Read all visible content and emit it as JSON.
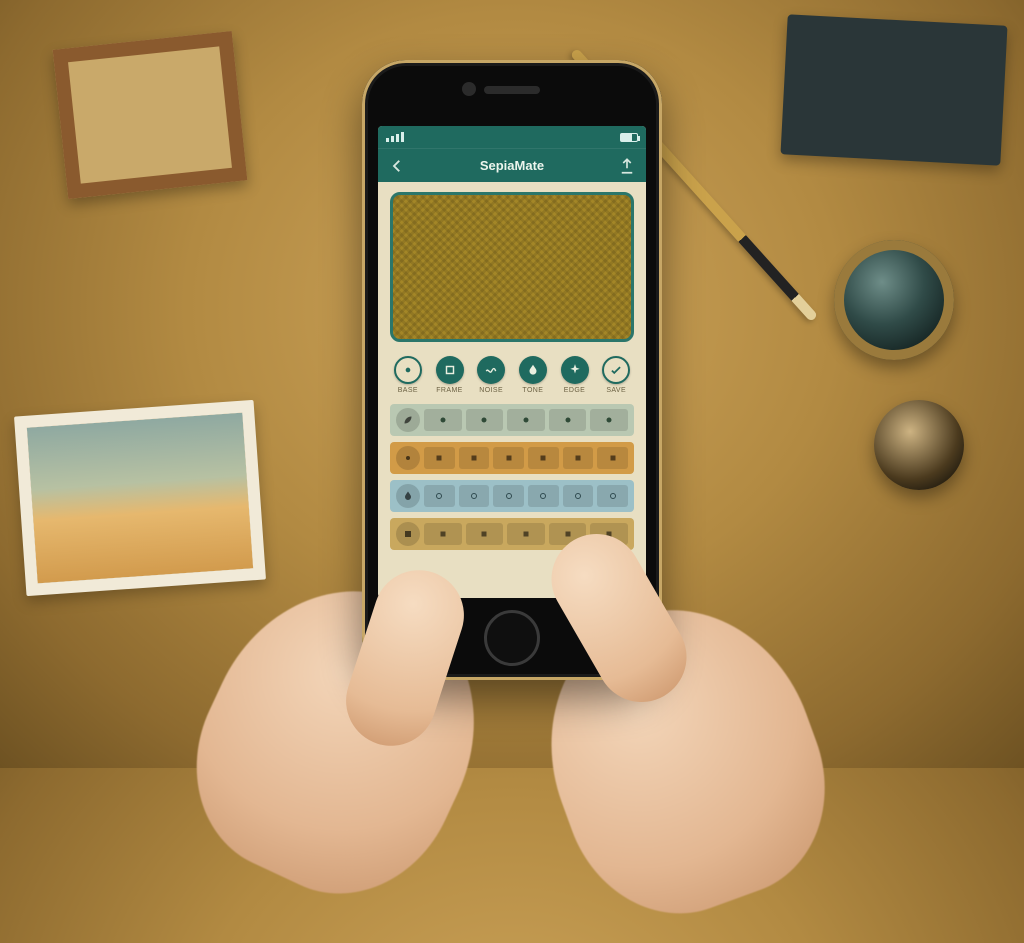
{
  "status": {
    "carrier_bars": 4
  },
  "header": {
    "title": "SepiaMate",
    "left_icon": "back-icon",
    "right_icon": "export-icon"
  },
  "chips": [
    {
      "label": "BASE",
      "icon": "sun-icon",
      "style": "outline"
    },
    {
      "label": "FRAME",
      "icon": "square-icon",
      "style": "solid"
    },
    {
      "label": "NOISE",
      "icon": "wave-icon",
      "style": "solid"
    },
    {
      "label": "TONE",
      "icon": "drop-icon",
      "style": "solid"
    },
    {
      "label": "EDGE",
      "icon": "spark-icon",
      "style": "solid"
    },
    {
      "label": "SAVE",
      "icon": "check-icon",
      "style": "outline"
    }
  ],
  "tool_rows": [
    {
      "tone": "a",
      "lead": "leaf-icon",
      "tools": [
        "blob1",
        "blob2",
        "blob3",
        "blob4",
        "blob5"
      ]
    },
    {
      "tone": "b",
      "lead": "sun-icon",
      "tools": [
        "sq",
        "sq",
        "txt",
        "sq",
        "sq",
        "sq"
      ]
    },
    {
      "tone": "c",
      "lead": "drop-icon",
      "tools": [
        "ring",
        "ring",
        "ring",
        "ring",
        "ring",
        "ring"
      ]
    },
    {
      "tone": "d",
      "lead": "square-icon",
      "tools": [
        "sq",
        "sq",
        "sq",
        "sq",
        "sq"
      ]
    }
  ],
  "colors": {
    "accent": "#1f6a5f",
    "canvas": "#e8dfc2",
    "warm": "#d29b47"
  }
}
